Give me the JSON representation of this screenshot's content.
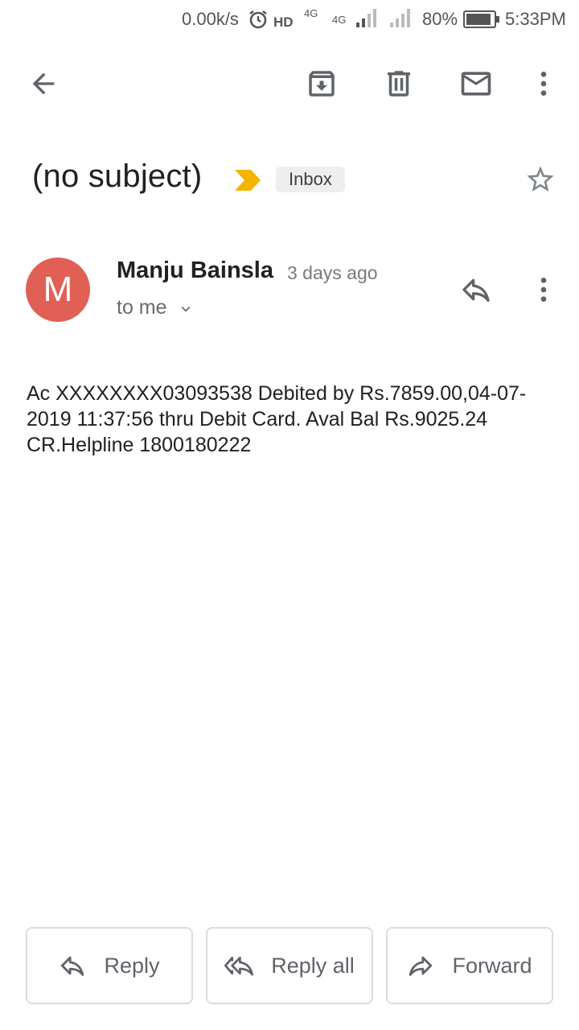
{
  "status_bar": {
    "net_speed": "0.00k/s",
    "hd": "HD",
    "lte1": "4G",
    "lte2": "4G",
    "battery_pct": "80%",
    "time": "5:33PM"
  },
  "toolbar": {
    "icons": [
      "back-arrow-icon",
      "archive-icon",
      "delete-icon",
      "mark-unread-icon",
      "more-vert-icon"
    ]
  },
  "email": {
    "subject": "(no subject)",
    "label": "Inbox",
    "sender_initial": "M",
    "sender_name": "Manju Bainsla",
    "time_ago": "3 days ago",
    "recipient": "to me",
    "body": "Ac XXXXXXXX03093538 Debited by Rs.7859.00,04-07-2019 11:37:56 thru Debit Card. Aval Bal Rs.9025.24 CR.Helpline 1800180222"
  },
  "actions": {
    "reply": "Reply",
    "reply_all": "Reply all",
    "forward": "Forward"
  },
  "colors": {
    "avatar": "#e06055",
    "importance_marker": "#f4b400",
    "icon_gray": "#5f6368"
  }
}
